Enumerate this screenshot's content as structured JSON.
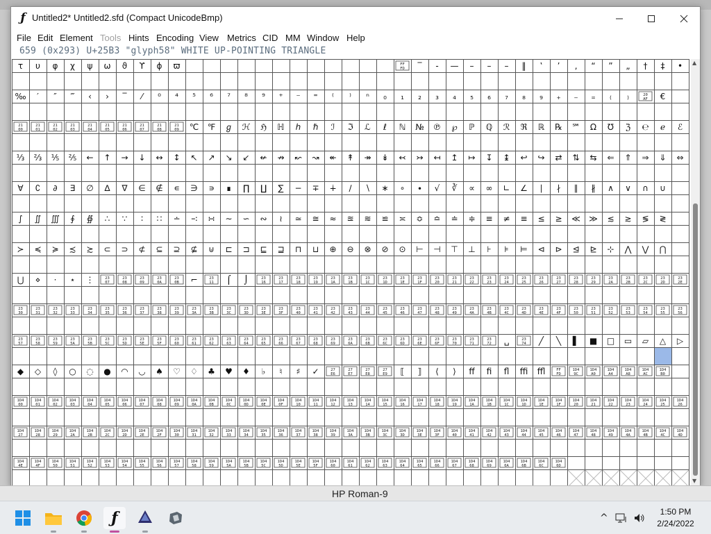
{
  "window": {
    "title": "Untitled2*  Untitled2.sfd (Compact UnicodeBmp)",
    "app_icon_glyph": "ƒ",
    "controls": {
      "minimize": "minimize",
      "maximize": "maximize",
      "close": "close"
    }
  },
  "menu": [
    {
      "label": "File",
      "enabled": true
    },
    {
      "label": "Edit",
      "enabled": true
    },
    {
      "label": "Element",
      "enabled": true
    },
    {
      "label": "Tools",
      "enabled": false
    },
    {
      "label": "Hints",
      "enabled": true
    },
    {
      "label": "Encoding",
      "enabled": true
    },
    {
      "label": "View",
      "enabled": true
    },
    {
      "label": "Metrics",
      "enabled": true
    },
    {
      "label": "CID",
      "enabled": true
    },
    {
      "label": "MM",
      "enabled": true
    },
    {
      "label": "Window",
      "enabled": true
    },
    {
      "label": "Help",
      "enabled": true
    }
  ],
  "info_line": "659 (0x293) U+25B3 \"glyph58\" WHITE UP-POINTING TRIANGLE",
  "grid": {
    "columns": 39,
    "rows": [
      {
        "glyphs": [
          "τ",
          "υ",
          "φ",
          "χ",
          "ψ",
          "ω",
          "ϑ",
          "ϒ",
          "ϕ",
          "ϖ",
          "",
          "",
          "",
          "",
          "",
          "",
          "",
          "",
          "",
          "",
          "",
          "",
          "FFFD",
          "‾",
          "‐",
          "—",
          "–",
          "–",
          "–",
          "‖",
          "‛",
          "’",
          "‚",
          "“",
          "”",
          "„",
          "†",
          "‡",
          "•",
          "…"
        ]
      },
      {
        "glyphs": [
          "‰",
          "′",
          "″",
          "‴",
          "‹",
          "›",
          "‾",
          "⁄",
          "⁰",
          "⁴",
          "⁵",
          "⁶",
          "⁷",
          "⁸",
          "⁹",
          "⁺",
          "⁻",
          "⁼",
          "⁽",
          "⁾",
          "ⁿ",
          "₀",
          "₁",
          "₂",
          "₃",
          "₄",
          "₅",
          "₆",
          "₇",
          "₈",
          "₉",
          "₊",
          "₋",
          "₌",
          "₍",
          "₎",
          "20AF",
          "€"
        ]
      },
      {
        "glyphs": [
          "2100",
          "2101",
          "2102",
          "2103",
          "2104",
          "2105",
          "2106",
          "2107",
          "2108",
          "2109",
          "℃",
          "℉",
          "ℊ",
          "ℋ",
          "ℌ",
          "ℍ",
          "ℎ",
          "ℏ",
          "ℐ",
          "ℑ",
          "ℒ",
          "ℓ",
          "ℕ",
          "№",
          "℗",
          "℘",
          "ℙ",
          "ℚ",
          "ℛ",
          "ℜ",
          "ℝ",
          "℞",
          "℠",
          "Ω",
          "℧",
          "ℨ",
          "℮",
          "ℯ",
          "ℰ",
          "ℱ",
          "ℳ",
          "ℵ",
          "ℶ"
        ]
      },
      {
        "glyphs": [
          "⅓",
          "⅔",
          "⅕",
          "⅖",
          "←",
          "↑",
          "→",
          "↓",
          "↔",
          "↕",
          "↖",
          "↗",
          "↘",
          "↙",
          "↚",
          "↛",
          "↜",
          "↝",
          "↞",
          "↟",
          "↠",
          "↡",
          "↢",
          "↣",
          "↤",
          "↥",
          "↦",
          "↧",
          "↨",
          "↩",
          "↪",
          "⇄",
          "⇅",
          "⇆",
          "⇐",
          "⇑",
          "⇒",
          "⇓",
          "⇔",
          "⇕",
          "⇖",
          "⇗"
        ]
      },
      {
        "glyphs": [
          "∀",
          "∁",
          "∂",
          "∃",
          "∅",
          "∆",
          "∇",
          "∈",
          "∉",
          "∊",
          "∋",
          "∍",
          "∎",
          "∏",
          "∐",
          "∑",
          "−",
          "∓",
          "∔",
          "∕",
          "∖",
          "∗",
          "∘",
          "∙",
          "√",
          "∛",
          "∝",
          "∞",
          "∟",
          "∠",
          "∣",
          "∤",
          "∥",
          "∦",
          "∧",
          "∨",
          "∩",
          "∪"
        ]
      },
      {
        "glyphs": [
          "∫",
          "∬",
          "∭",
          "∮",
          "∯",
          "∴",
          "∵",
          "∶",
          "∷",
          "∸",
          "∹",
          "∺",
          "∼",
          "∽",
          "∾",
          "≀",
          "≃",
          "≅",
          "≈",
          "≊",
          "≋",
          "≌",
          "≍",
          "≎",
          "≏",
          "≐",
          "≑",
          "≡",
          "≠",
          "≡",
          "≤",
          "≥",
          "≪",
          "≫",
          "≲",
          "≳",
          "≶",
          "≷"
        ]
      },
      {
        "glyphs": [
          "≻",
          "≼",
          "≽",
          "≾",
          "≿",
          "⊂",
          "⊃",
          "⊄",
          "⊆",
          "⊇",
          "⊈",
          "⊍",
          "⊏",
          "⊐",
          "⊑",
          "⊒",
          "⊓",
          "⊔",
          "⊕",
          "⊖",
          "⊗",
          "⊘",
          "⊙",
          "⊢",
          "⊣",
          "⊤",
          "⊥",
          "⊦",
          "⊧",
          "⊨",
          "⊲",
          "⊳",
          "⊴",
          "⊵",
          "⊹",
          "⋀",
          "⋁",
          "⋂"
        ]
      },
      {
        "glyphs": [
          "⋃",
          "⋄",
          "⋅",
          "⋆",
          "⋮",
          "2307",
          "2308",
          "2309",
          "230A",
          "230B",
          "⌐",
          "2311",
          "⌠",
          "⌡",
          "2316",
          "2317",
          "2318",
          "2319",
          "231A",
          "231B",
          "231C",
          "231D",
          "231E",
          "231F",
          "2320",
          "2321",
          "2322",
          "2323",
          "2324",
          "2325",
          "2326",
          "2327",
          "2328",
          "2329",
          "232A",
          "232B",
          "232C",
          "232D",
          "232E",
          "232F"
        ]
      },
      {
        "glyphs": [
          "2330",
          "2331",
          "2332",
          "2333",
          "2334",
          "2335",
          "2336",
          "2337",
          "2338",
          "2339",
          "233A",
          "233B",
          "233C",
          "233D",
          "233E",
          "233F",
          "2340",
          "2341",
          "2342",
          "2343",
          "2344",
          "2345",
          "2346",
          "2347",
          "2348",
          "2349",
          "234A",
          "234B",
          "234C",
          "234D",
          "234E",
          "234F",
          "2350",
          "2351",
          "2352",
          "2353",
          "2354",
          "2355",
          "2356"
        ]
      },
      {
        "glyphs": [
          "2357",
          "2358",
          "2359",
          "235A",
          "235B",
          "235C",
          "235D",
          "235E",
          "235F",
          "2360",
          "2361",
          "2362",
          "2363",
          "2364",
          "2365",
          "2366",
          "2367",
          "2368",
          "2369",
          "236A",
          "236B",
          "236C",
          "236D",
          "236E",
          "236F",
          "2370",
          "2371",
          "2372",
          "␣",
          "2374",
          "╱",
          "╲",
          "▌",
          "■",
          "□",
          "▭",
          "▱",
          "△",
          "▷",
          "▽",
          "◁"
        ]
      },
      {
        "glyphs": [
          "◆",
          "◇",
          "◊",
          "○",
          "◌",
          "●",
          "◠",
          "◡",
          "♠",
          "♡",
          "♢",
          "♣",
          "♥",
          "♦",
          "♭",
          "♮",
          "♯",
          "✓",
          "27E6",
          "27E7",
          "27E8",
          "27E9",
          "⟦",
          "⟧",
          "⟨",
          "⟩",
          "ﬀ",
          "ﬁ",
          "ﬂ",
          "ﬃ",
          "ﬄ",
          "FFFD",
          "1D49C",
          "1D4A0",
          "1D4A4",
          "1D4A8",
          "1D4AC",
          "1D4B0"
        ]
      },
      {
        "glyphs": [
          "1D400",
          "1D401",
          "1D402",
          "1D403",
          "1D404",
          "1D405",
          "1D406",
          "1D407",
          "1D408",
          "1D409",
          "1D40A",
          "1D40B",
          "1D40C",
          "1D40D",
          "1D40E",
          "1D40F",
          "1D410",
          "1D411",
          "1D412",
          "1D413",
          "1D414",
          "1D415",
          "1D416",
          "1D417",
          "1D418",
          "1D419",
          "1D41A",
          "1D41B",
          "1D41C",
          "1D41D",
          "1D41E",
          "1D41F",
          "1D420",
          "1D421",
          "1D422",
          "1D423",
          "1D424",
          "1D425",
          "1D426"
        ]
      },
      {
        "glyphs": [
          "1D427",
          "1D428",
          "1D429",
          "1D42A",
          "1D42B",
          "1D42C",
          "1D42D",
          "1D42E",
          "1D42F",
          "1D430",
          "1D431",
          "1D432",
          "1D433",
          "1D434",
          "1D435",
          "1D436",
          "1D437",
          "1D438",
          "1D439",
          "1D43A",
          "1D43B",
          "1D43C",
          "1D43D",
          "1D43E",
          "1D43F",
          "1D440",
          "1D441",
          "1D442",
          "1D443",
          "1D444",
          "1D445",
          "1D446",
          "1D447",
          "1D448",
          "1D449",
          "1D44A",
          "1D44B",
          "1D44C",
          "1D44D"
        ]
      },
      {
        "glyphs": [
          "1D44E",
          "1D44F",
          "1D450",
          "1D451",
          "1D452",
          "1D453",
          "1D454",
          "1D455",
          "1D456",
          "1D457",
          "1D458",
          "1D459",
          "1D45A",
          "1D45B",
          "1D45C",
          "1D45D",
          "1D45E",
          "1D45F",
          "1D460",
          "1D461",
          "1D462",
          "1D463",
          "1D464",
          "1D465",
          "1D466",
          "1D467",
          "1D468",
          "1D469",
          "1D46A",
          "1D46B",
          "1D46C",
          "1D46D",
          "",
          "",
          "",
          "",
          "",
          "",
          "",
          ""
        ]
      }
    ],
    "selected_glyph": "△"
  },
  "statusbar": {
    "text": "HP Roman-9"
  },
  "taskbar": {
    "icons": [
      "windows-start-icon",
      "file-explorer-icon",
      "chrome-icon",
      "fontforge-icon",
      "inkscape-icon",
      "app-icon"
    ],
    "tray": {
      "chevron": "^",
      "time": "1:50 PM",
      "date": "2/24/2022"
    }
  }
}
